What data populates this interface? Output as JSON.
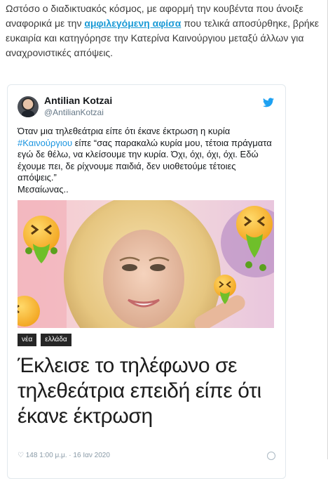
{
  "article": {
    "line1_before": "Ωστόσο ο διαδικτυακός κόσμος, με αφορμή την κουβέντα που άνοιξε αναφορικά με την ",
    "link": "αμφιλεγόμενη αφίσα",
    "line1_after": " που τελικά αποσύρθηκε, βρήκε ευκαιρία και κατηγόρησε την Κατερίνα Καινούργιου μεταξύ άλλων για αναχρονιστικές απόψεις."
  },
  "tweet": {
    "author_name": "Antilian Kotzai",
    "author_handle": "@AntilianKotzai",
    "text_before_tag": "Όταν μια τηλεθεάτρια είπε ότι έκανε έκτρωση η κυρία ",
    "hashtag": "#Καινούργιου",
    "text_after_tag": " είπε “σας παρακαλώ κυρία μου, τέτοια πράγματα εγώ δε θέλω, να κλείσουμε την κυρία. Όχι, όχι, όχι, όχι. Εδώ έχουμε πει, δε ρίχνουμε παιδιά, δεν υιοθετούμε τέτοιες απόψεις.”",
    "text_last": "Μεσαίωνας..",
    "badges": [
      "νέα",
      "ελλάδα"
    ],
    "headline": "Έκλεισε το τηλέφωνο σε τηλεθεάτρια επειδή είπε ότι έκανε έκτρωση",
    "meta": "♡ 148   1:00 μ.μ. · 16 Ιαν 2020"
  },
  "colors": {
    "link": "#1a9ad6",
    "hashtag": "#1b95e0",
    "twitter_blue": "#1da1f2"
  },
  "icons": [
    "twitter-bird-icon",
    "vomiting-face-emoji",
    "info-icon"
  ]
}
